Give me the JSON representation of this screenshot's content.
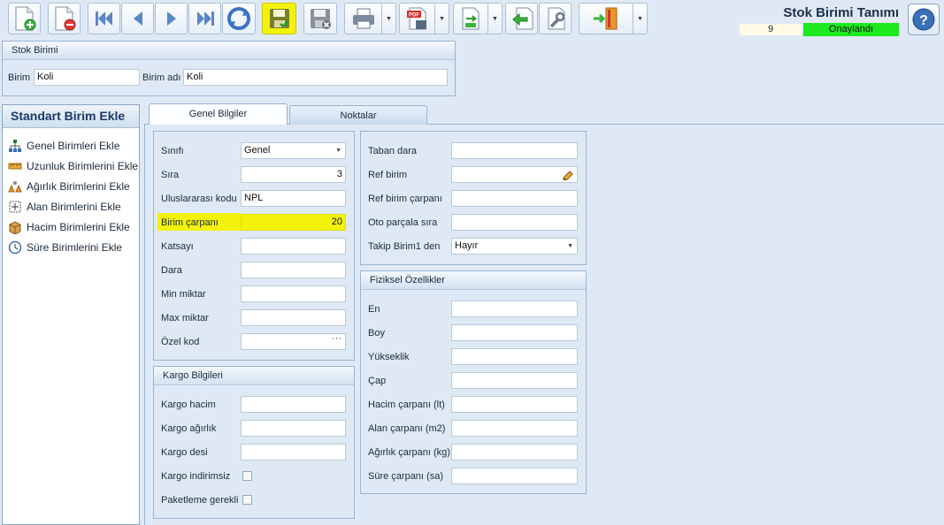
{
  "toolbar": {
    "buttons": [
      {
        "name": "new-record-button",
        "icon": "new-document-icon"
      },
      {
        "name": "delete-record-button",
        "icon": "delete-document-icon"
      },
      {
        "name": "first-record-button",
        "icon": "first-icon"
      },
      {
        "name": "previous-record-button",
        "icon": "previous-icon"
      },
      {
        "name": "next-record-button",
        "icon": "next-icon"
      },
      {
        "name": "last-record-button",
        "icon": "last-icon"
      },
      {
        "name": "refresh-button",
        "icon": "refresh-icon"
      },
      {
        "name": "save-button",
        "icon": "save-icon",
        "highlight": "#f3f20a"
      },
      {
        "name": "cancel-save-button",
        "icon": "save-cancel-icon"
      },
      {
        "name": "print-button",
        "icon": "printer-icon"
      },
      {
        "name": "export-pdf-button",
        "icon": "pdf-icon"
      },
      {
        "name": "export-button",
        "icon": "export-icon"
      },
      {
        "name": "back-button",
        "icon": "back-arrow-icon"
      },
      {
        "name": "settings-button",
        "icon": "wrench-icon"
      },
      {
        "name": "exit-button",
        "icon": "exit-door-icon"
      }
    ]
  },
  "header": {
    "title": "Stok Birimi Tanımı",
    "record_number": "9",
    "status": "Onaylandı",
    "status_color": "#1ee81e"
  },
  "stok_birimi": {
    "title": "Stok Birimi",
    "birim_label": "Birim",
    "birim_value": "Koli",
    "birim_adi_label": "Birim adı",
    "birim_adi_value": "Koli"
  },
  "left_panel": {
    "title": "Standart Birim Ekle",
    "items": [
      {
        "label": "Genel Birimleri Ekle",
        "icon": "hierarchy-icon"
      },
      {
        "label": "Uzunluk Birimlerini Ekle",
        "icon": "ruler-icon"
      },
      {
        "label": "Ağırlık Birimlerini Ekle",
        "icon": "weights-icon"
      },
      {
        "label": "Alan Birimlerini Ekle",
        "icon": "area-icon"
      },
      {
        "label": "Hacim Birimlerini Ekle",
        "icon": "box-icon"
      },
      {
        "label": "Süre Birimlerini Ekle",
        "icon": "clock-icon"
      }
    ]
  },
  "tabs": [
    {
      "label": "Genel Bilgiler",
      "active": true
    },
    {
      "label": "Noktalar",
      "active": false
    }
  ],
  "genel": {
    "sinifi_label": "Sınıfı",
    "sinifi_value": "Genel",
    "sira_label": "Sıra",
    "sira_value": "3",
    "uluslararasi_kodu_label": "Uluslararası kodu",
    "uluslararasi_kodu_value": "NPL",
    "birim_carpani_label": "Birim çarpanı",
    "birim_carpani_value": "20",
    "katsayi_label": "Katsayı",
    "dara_label": "Dara",
    "min_miktar_label": "Min miktar",
    "max_miktar_label": "Max miktar",
    "ozel_kod_label": "Özel kod",
    "ozel_kod_button": "···"
  },
  "kargo": {
    "title": "Kargo Bilgileri",
    "hacim_label": "Kargo hacim",
    "agirlik_label": "Kargo ağırlık",
    "desi_label": "Kargo desi",
    "indirimsiz_label": "Kargo indirimsiz",
    "paketleme_label": "Paketleme gerekli"
  },
  "ref": {
    "taban_dara_label": "Taban dara",
    "ref_birim_label": "Ref birim",
    "ref_birim_carpani_label": "Ref birim çarpanı",
    "oto_parcala_sira_label": "Oto parçala sıra",
    "takip_birim1_label": "Takip Birim1 den",
    "takip_birim1_value": "Hayır"
  },
  "fiziksel": {
    "title": "Fiziksel Özellikler",
    "en_label": "En",
    "boy_label": "Boy",
    "yukseklik_label": "Yükseklik",
    "cap_label": "Çap",
    "hacim_carpani_label": "Hacim çarpanı (lt)",
    "alan_carpani_label": "Alan çarpanı (m2)",
    "agirlik_carpani_label": "Ağırlık çarpanı (kg)",
    "sure_carpani_label": "Süre çarpanı (sa)"
  }
}
